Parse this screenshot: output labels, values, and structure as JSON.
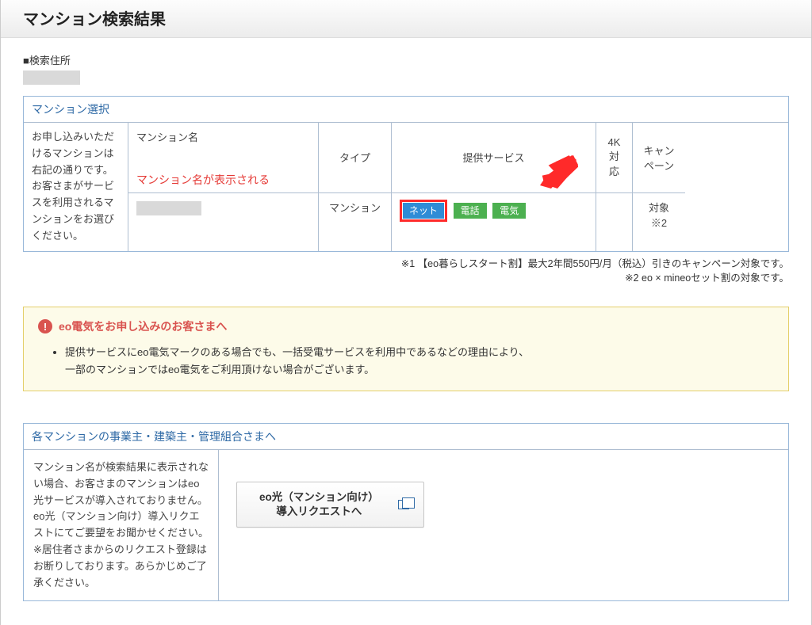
{
  "page_title": "マンション検索結果",
  "search_address_label": "■検索住所",
  "selection": {
    "section_title": "マンション選択",
    "left_info": "お申し込みいただけるマンションは右記の通りです。お客さまがサービスを利用されるマンションをお選びください。",
    "headers": {
      "mansion_name": "マンション名",
      "type": "タイプ",
      "services": "提供サービス",
      "four_k": "4K\n対応",
      "campaign": "キャンペーン"
    },
    "mansion_name_annotation": "マンション名が表示される",
    "row": {
      "type_value": "マンション",
      "services": {
        "net": "ネット",
        "tel": "電話",
        "elec": "電気"
      },
      "four_k_value": "",
      "campaign_value": "対象※2"
    }
  },
  "footnotes": {
    "n1": "※1 【eo暮らしスタート割】最大2年間550円/月（税込）引きのキャンペーン対象です。",
    "n2": "※2 eo × mineoセット割の対象です。"
  },
  "warning": {
    "title": "eo電気をお申し込みのお客さまへ",
    "bullet": "提供サービスにeo電気マークのある場合でも、一括受電サービスを利用中であるなどの理由により、\n一部のマンションではeo電気をご利用頂けない場合がございます。"
  },
  "owners": {
    "section_title": "各マンションの事業主・建築主・管理組合さまへ",
    "left_text": "マンション名が検索結果に表示されない場合、お客さまのマンションはeo光サービスが導入されておりません。\neo光（マンション向け）導入リクエストにてご要望をお聞かせください。\n※居住者さまからのリクエスト登録はお断りしております。あらかじめご了承ください。",
    "button": {
      "line1": "eo光（マンション向け）",
      "line2": "導入リクエストへ"
    }
  }
}
